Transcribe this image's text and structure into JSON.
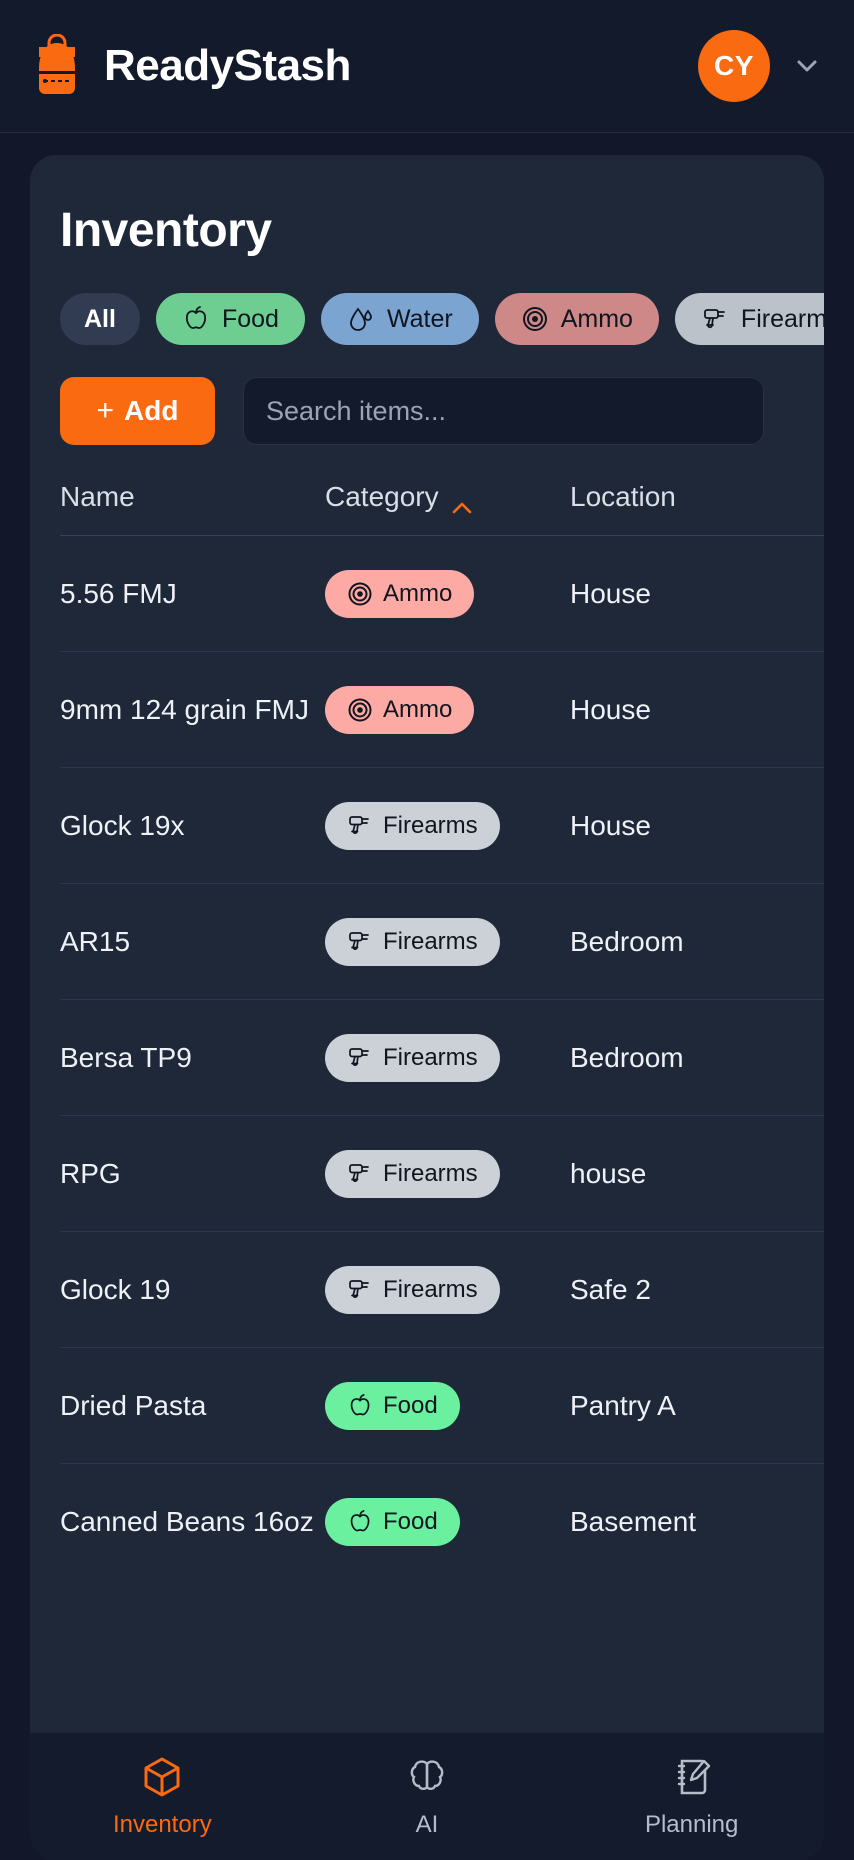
{
  "header": {
    "brand_name": "ReadyStash",
    "logo_icon": "backpack-icon",
    "avatar_initials": "CY",
    "chevron_icon": "chevron-down-icon",
    "accent_color": "#f96a11"
  },
  "main": {
    "title": "Inventory",
    "filters": [
      {
        "label": "All",
        "icon": "none",
        "bg": "#313c52"
      },
      {
        "label": "Food",
        "icon": "apple-icon",
        "bg": "#6ece92"
      },
      {
        "label": "Water",
        "icon": "droplet-icon",
        "bg": "#7ba4d1"
      },
      {
        "label": "Ammo",
        "icon": "target-icon",
        "bg": "#cf8888"
      },
      {
        "label": "Firearms",
        "icon": "pistol-icon",
        "bg": "#bcc2c9"
      },
      {
        "label": "",
        "icon": "none",
        "bg": "#e0915c"
      }
    ],
    "add_label": "Add",
    "add_plus": "+",
    "search_placeholder": "Search items...",
    "search_value": "",
    "table": {
      "columns": [
        "Name",
        "Category",
        "Location"
      ],
      "sorted_column": "Category",
      "sort_direction": "asc",
      "rows": [
        {
          "name": "5.56 FMJ",
          "category": "Ammo",
          "cat_class": "ammo",
          "cat_icon": "target-icon",
          "location": "House"
        },
        {
          "name": "9mm 124 grain FMJ",
          "category": "Ammo",
          "cat_class": "ammo",
          "cat_icon": "target-icon",
          "location": "House"
        },
        {
          "name": "Glock 19x",
          "category": "Firearms",
          "cat_class": "firearms",
          "cat_icon": "pistol-icon",
          "location": "House"
        },
        {
          "name": "AR15",
          "category": "Firearms",
          "cat_class": "firearms",
          "cat_icon": "pistol-icon",
          "location": "Bedroom"
        },
        {
          "name": "Bersa TP9",
          "category": "Firearms",
          "cat_class": "firearms",
          "cat_icon": "pistol-icon",
          "location": "Bedroom"
        },
        {
          "name": "RPG",
          "category": "Firearms",
          "cat_class": "firearms",
          "cat_icon": "pistol-icon",
          "location": "house"
        },
        {
          "name": "Glock 19",
          "category": "Firearms",
          "cat_class": "firearms",
          "cat_icon": "pistol-icon",
          "location": "Safe 2"
        },
        {
          "name": "Dried Pasta",
          "category": "Food",
          "cat_class": "food",
          "cat_icon": "apple-icon",
          "location": "Pantry A"
        },
        {
          "name": "Canned Beans 16oz",
          "category": "Food",
          "cat_class": "food",
          "cat_icon": "apple-icon",
          "location": "Basement"
        }
      ]
    }
  },
  "bottom_nav": {
    "items": [
      {
        "label": "Inventory",
        "icon": "cube-icon",
        "active": true
      },
      {
        "label": "AI",
        "icon": "brain-icon",
        "active": false
      },
      {
        "label": "Planning",
        "icon": "notebook-pencil-icon",
        "active": false
      }
    ]
  }
}
